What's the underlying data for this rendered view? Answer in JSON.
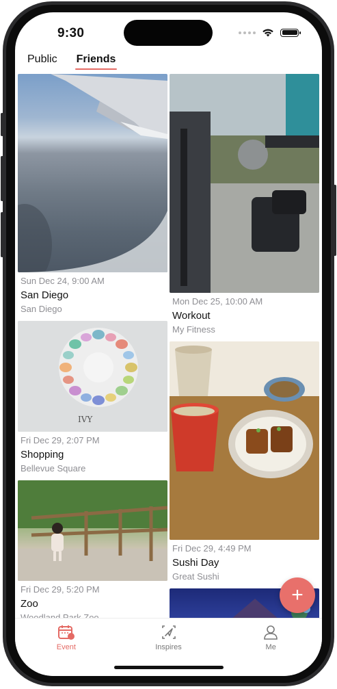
{
  "status_bar": {
    "time": "9:30"
  },
  "tabs": [
    {
      "label": "Public",
      "active": false
    },
    {
      "label": "Friends",
      "active": true
    }
  ],
  "feed": {
    "left": [
      {
        "date": "Sun Dec 24, 9:00 AM",
        "title": "San Diego",
        "place": "San Diego",
        "photo": "airplane-window-photo"
      },
      {
        "date": "Fri Dec 29, 2:07 PM",
        "title": "Shopping",
        "place": "Bellevue Square",
        "photo": "color-palette-box-photo"
      },
      {
        "date": "Fri Dec 29, 5:20 PM",
        "title": "Zoo",
        "place": "Woodland Park Zoo",
        "photo": "child-at-zoo-photo"
      }
    ],
    "right": [
      {
        "date": "Mon Dec 25, 10:00 AM",
        "title": "Workout",
        "place": "My Fitness",
        "photo": "gym-machine-photo"
      },
      {
        "date": "Fri Dec 29, 4:49 PM",
        "title": "Sushi Day",
        "place": "Great Sushi",
        "photo": "unagi-don-photo"
      },
      {
        "photo": "night-scene-photo"
      }
    ]
  },
  "fab": {
    "icon": "plus-icon",
    "label": "+"
  },
  "tabbar": [
    {
      "label": "Event",
      "icon": "calendar-icon",
      "active": true
    },
    {
      "label": "Inspires",
      "icon": "navigation-icon",
      "active": false
    },
    {
      "label": "Me",
      "icon": "person-icon",
      "active": false
    }
  ],
  "colors": {
    "accent": "#e46a64",
    "fab": "#e8706b",
    "secondary_text": "#8e8e93"
  }
}
